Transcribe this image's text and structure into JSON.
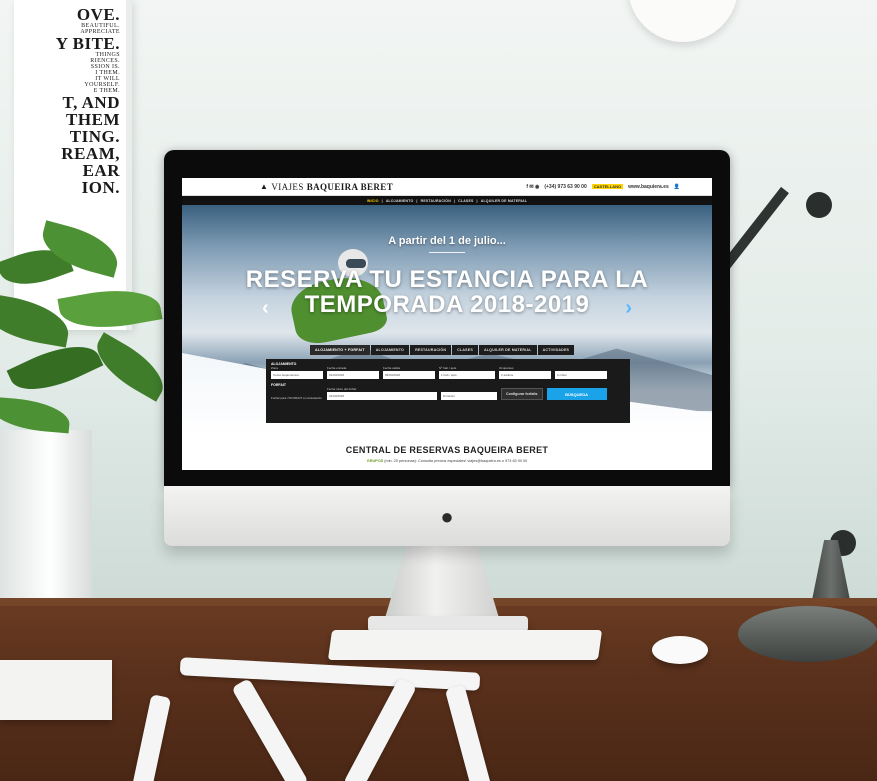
{
  "poster": {
    "lines": [
      {
        "text": "OVE.",
        "size": "big"
      },
      {
        "text": "BEAUTIFUL.",
        "size": "sm"
      },
      {
        "text": "APPRECIATE",
        "size": "sm"
      },
      {
        "text": "Y BITE.",
        "size": "big"
      },
      {
        "text": "THINGS",
        "size": "sm"
      },
      {
        "text": "RIENCES.",
        "size": "sm"
      },
      {
        "text": "SSION IS.",
        "size": "sm"
      },
      {
        "text": "I THEM.",
        "size": "sm"
      },
      {
        "text": "IT WILL",
        "size": "sm"
      },
      {
        "text": "YOURSELF.",
        "size": "sm"
      },
      {
        "text": "E THEM.",
        "size": "sm"
      },
      {
        "text": "T, AND",
        "size": "big"
      },
      {
        "text": "THEM",
        "size": "big"
      },
      {
        "text": "TING.",
        "size": "big"
      },
      {
        "text": "REAM,",
        "size": "big"
      },
      {
        "text": "EAR",
        "size": "big"
      },
      {
        "text": "ION.",
        "size": "big"
      }
    ]
  },
  "website": {
    "brand_prefix": "VIAJES",
    "brand_name": "BAQUEIRA BERET",
    "phone": "(+34) 973 63 90 00",
    "language": "CASTELLANO",
    "url_short": "www.baquiera.es",
    "nav": [
      "INICIO",
      "ALOJAMIENTO",
      "RESTAURACIÓN",
      "CLASES",
      "ALQUILER DE MATERIAL"
    ],
    "hero_subtitle": "A partir del 1 de julio...",
    "hero_title_line1": "RESERVA TU ESTANCIA PARA LA",
    "hero_title_line2": "TEMPORADA 2018-2019",
    "tabs": [
      "ALOJAMIENTO + FORFAIT",
      "ALOJAMIENTO",
      "RESTAURACIÓN",
      "CLASES",
      "ALQUILER DE MATERIAL",
      "ACTIVIDADES"
    ],
    "form": {
      "section1": "ALOJAMIENTO",
      "zona_label": "Zona",
      "zona_value": "Todos Alojamientos",
      "entrada_label": "Fecha entrada",
      "entrada_value": "01/03/2018",
      "salida_label": "Fecha salida",
      "salida_value": "05/03/2018",
      "nhab_label": "Nº hab / apts",
      "nhab_value": "1 hab / apts",
      "ocupantes_label": "Ocupantes",
      "ocupantes_value": "2 adultos",
      "ninos_value": "0 niños",
      "section2": "FORFAIT",
      "forfait_note": "Forfait para 7/FORFAIT en la Estación",
      "forfait_date_label": "Fecha inicio del forfait",
      "forfait_date_value": "01/03/2018",
      "duracion_value": "Duración",
      "configure_label": "Configurar forfaits",
      "search_label": "BÚSQUEDA"
    },
    "central_title": "CENTRAL DE RESERVAS BAQUEIRA BERET",
    "central_groups": "GRUPOS",
    "central_text": "(min. 20 personas): Consulta precios especiales! viajes@baqueira.es o 973 63 90 00"
  },
  "colors": {
    "accent_yellow": "#ffd400",
    "accent_blue": "#1aa3e8",
    "brand_green": "#6a9a20"
  }
}
